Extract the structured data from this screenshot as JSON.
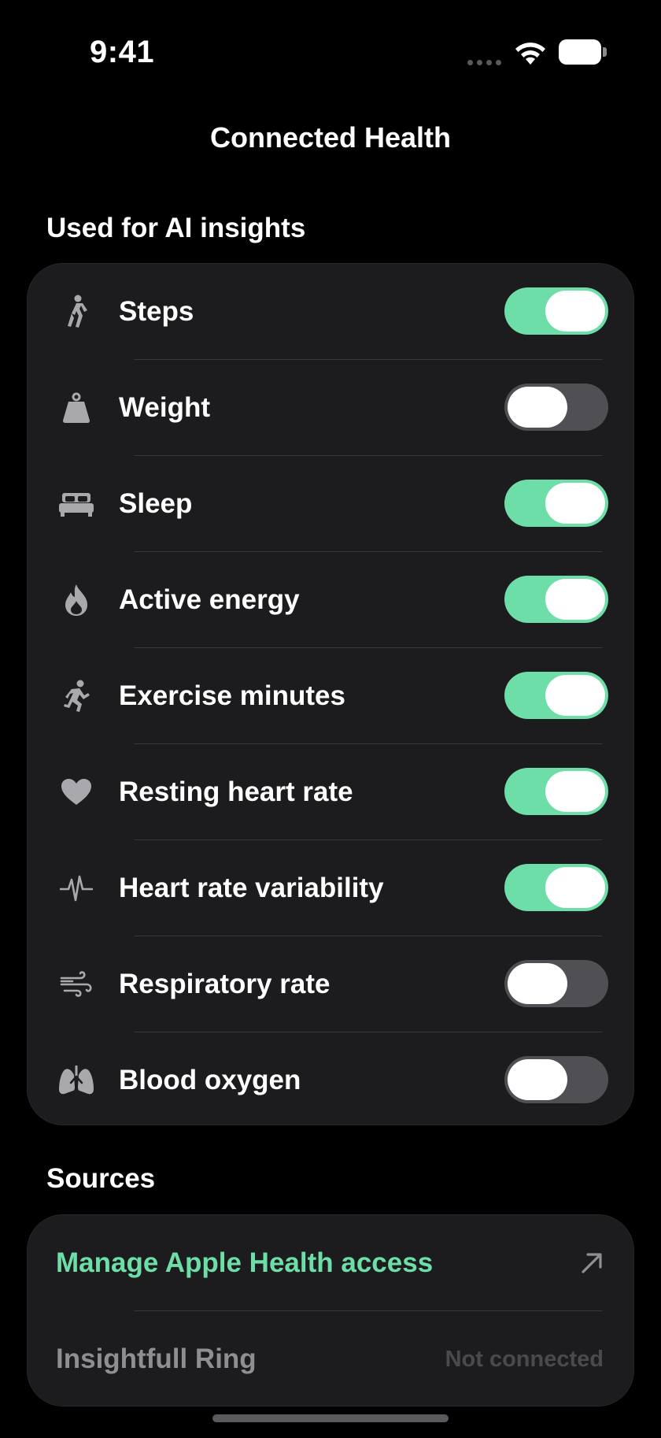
{
  "status_bar": {
    "time": "9:41"
  },
  "nav": {
    "title": "Connected Health"
  },
  "insights_section": {
    "title": "Used for AI insights",
    "items": [
      {
        "label": "Steps",
        "icon": "walking-icon",
        "enabled": true
      },
      {
        "label": "Weight",
        "icon": "scale-weight-icon",
        "enabled": false
      },
      {
        "label": "Sleep",
        "icon": "bed-icon",
        "enabled": true
      },
      {
        "label": "Active energy",
        "icon": "flame-icon",
        "enabled": true
      },
      {
        "label": "Exercise minutes",
        "icon": "running-icon",
        "enabled": true
      },
      {
        "label": "Resting heart rate",
        "icon": "heart-icon",
        "enabled": true
      },
      {
        "label": "Heart rate variability",
        "icon": "waveform-icon",
        "enabled": true
      },
      {
        "label": "Respiratory rate",
        "icon": "wind-icon",
        "enabled": false
      },
      {
        "label": "Blood oxygen",
        "icon": "lungs-icon",
        "enabled": false
      }
    ]
  },
  "sources_section": {
    "title": "Sources",
    "manage_label": "Manage Apple Health access",
    "ring_label": "Insightfull Ring",
    "ring_status": "Not connected"
  },
  "colors": {
    "accent": "#6edea8",
    "toggle_off": "#505054",
    "card_bg": "#1c1c1e",
    "background": "#000000"
  }
}
